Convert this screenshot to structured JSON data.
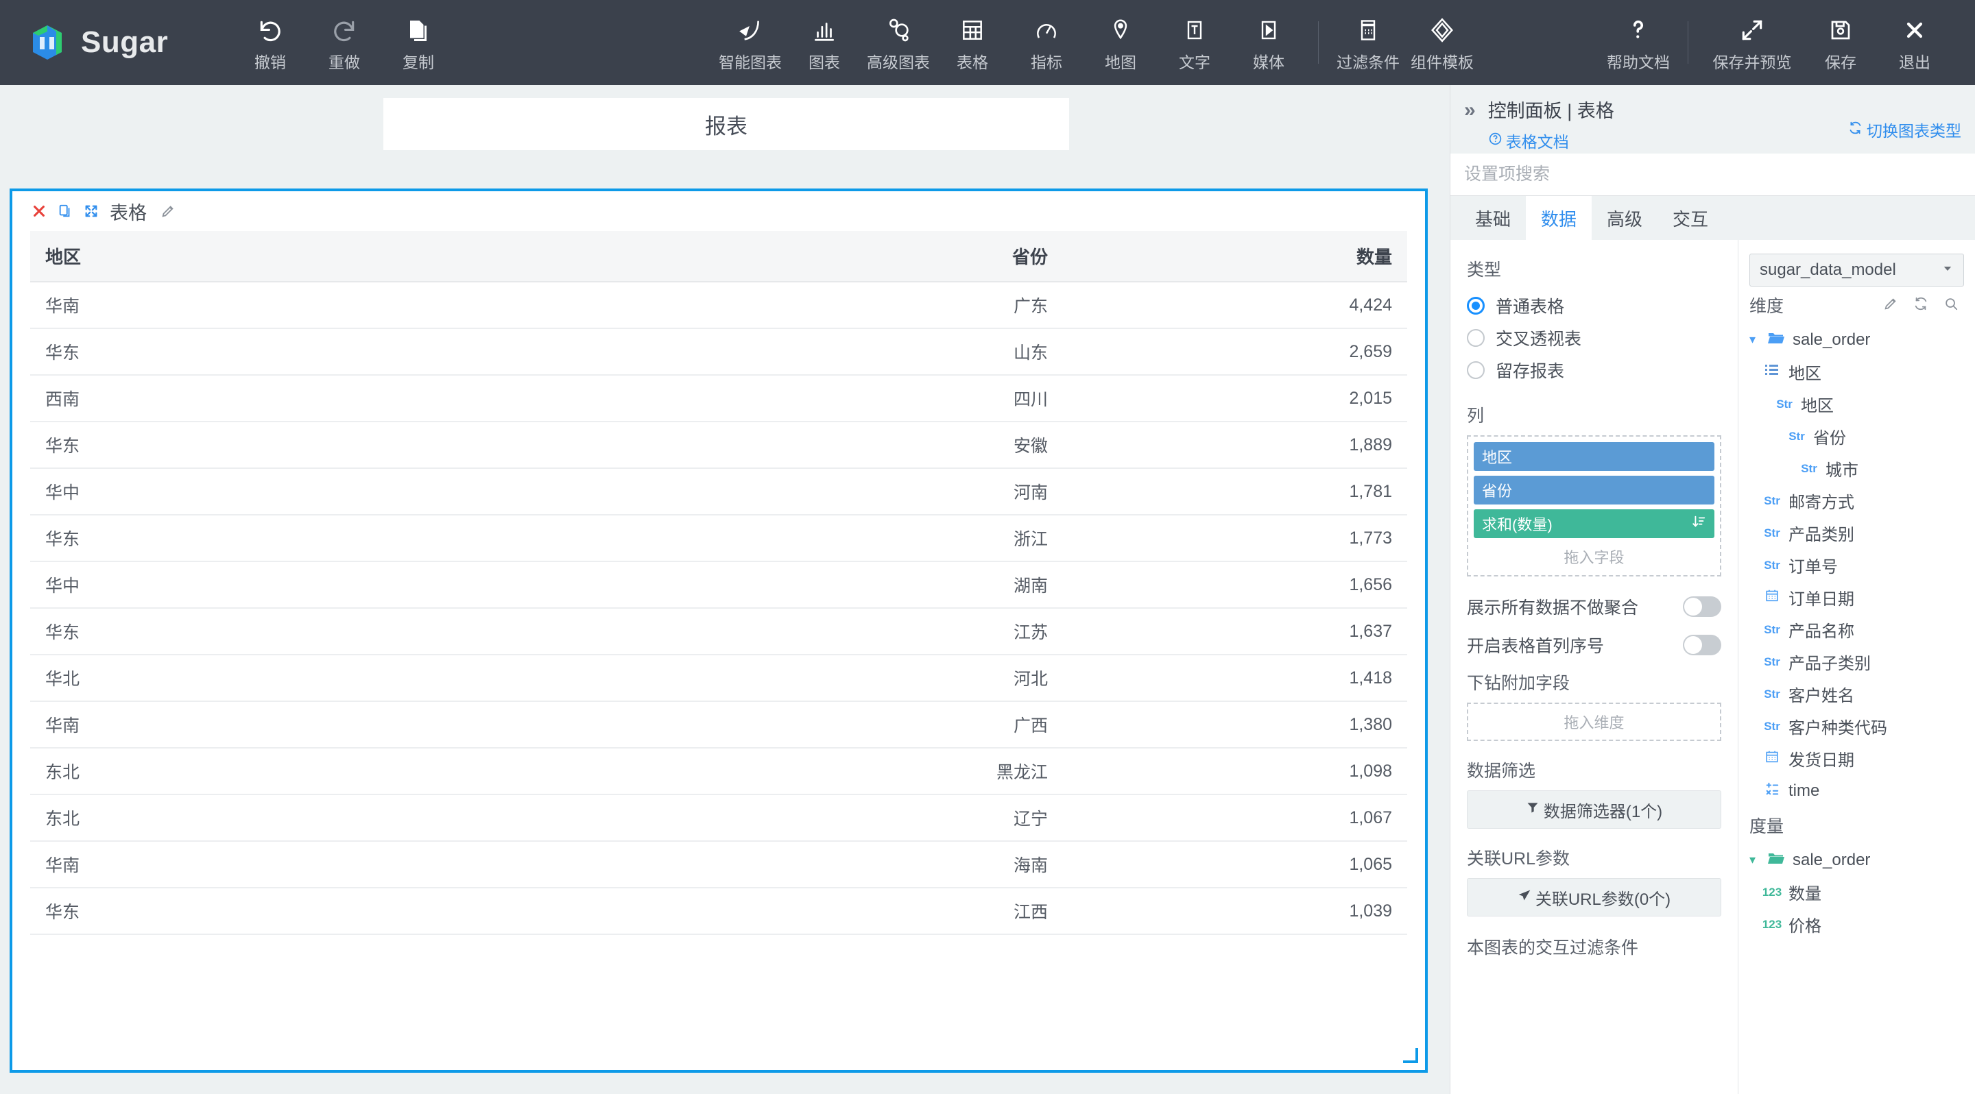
{
  "app": {
    "name": "Sugar"
  },
  "toolbar": {
    "left": [
      {
        "label": "撤销",
        "icon": "undo-icon"
      },
      {
        "label": "重做",
        "icon": "redo-icon"
      },
      {
        "label": "复制",
        "icon": "copy-icon"
      }
    ],
    "center": [
      {
        "label": "智能图表",
        "icon": "smart-chart-icon"
      },
      {
        "label": "图表",
        "icon": "bar-chart-icon"
      },
      {
        "label": "高级图表",
        "icon": "advanced-chart-icon"
      },
      {
        "label": "表格",
        "icon": "table-icon"
      },
      {
        "label": "指标",
        "icon": "metric-icon"
      },
      {
        "label": "地图",
        "icon": "map-icon"
      },
      {
        "label": "文字",
        "icon": "text-icon"
      },
      {
        "label": "媒体",
        "icon": "media-icon"
      }
    ],
    "center2": [
      {
        "label": "过滤条件",
        "icon": "filter-condition-icon"
      },
      {
        "label": "组件模板",
        "icon": "component-template-icon"
      }
    ],
    "right1": [
      {
        "label": "帮助文档",
        "icon": "question-mark-icon"
      }
    ],
    "right2": [
      {
        "label": "保存并预览",
        "icon": "expand-arrows-icon"
      },
      {
        "label": "保存",
        "icon": "floppy-disk-icon"
      },
      {
        "label": "退出",
        "icon": "close-x-icon"
      }
    ]
  },
  "canvas": {
    "report_title": "报表",
    "widget": {
      "title": "表格",
      "actions": [
        {
          "name": "delete-widget",
          "icon": "red-x-icon"
        },
        {
          "name": "copy-widget",
          "icon": "duplicate-icon"
        },
        {
          "name": "fullscreen-widget",
          "icon": "expand-icon"
        }
      ],
      "edit_icon": "pencil-icon"
    }
  },
  "chart_data": {
    "type": "table",
    "title": "表格",
    "columns": [
      "地区",
      "省份",
      "数量"
    ],
    "rows": [
      [
        "华南",
        "广东",
        "4,424"
      ],
      [
        "华东",
        "山东",
        "2,659"
      ],
      [
        "西南",
        "四川",
        "2,015"
      ],
      [
        "华东",
        "安徽",
        "1,889"
      ],
      [
        "华中",
        "河南",
        "1,781"
      ],
      [
        "华东",
        "浙江",
        "1,773"
      ],
      [
        "华中",
        "湖南",
        "1,656"
      ],
      [
        "华东",
        "江苏",
        "1,637"
      ],
      [
        "华北",
        "河北",
        "1,418"
      ],
      [
        "华南",
        "广西",
        "1,380"
      ],
      [
        "东北",
        "黑龙江",
        "1,098"
      ],
      [
        "东北",
        "辽宁",
        "1,067"
      ],
      [
        "华南",
        "海南",
        "1,065"
      ],
      [
        "华东",
        "江西",
        "1,039"
      ]
    ]
  },
  "panel": {
    "collapse_icon": "double-chevron-right-icon",
    "breadcrumb": "控制面板 | 表格",
    "doc_link": "表格文档",
    "doc_icon": "question-circle-icon",
    "switch_chart_type": "切换图表类型",
    "switch_icon": "refresh-icon",
    "search_placeholder": "设置项搜索",
    "search_value": "",
    "tabs": [
      {
        "label": "基础",
        "active": false
      },
      {
        "label": "数据",
        "active": true
      },
      {
        "label": "高级",
        "active": false
      },
      {
        "label": "交互",
        "active": false
      }
    ],
    "settings": {
      "type_label": "类型",
      "type_options": [
        {
          "label": "普通表格",
          "selected": true
        },
        {
          "label": "交叉透视表",
          "selected": false
        },
        {
          "label": "留存报表",
          "selected": false
        }
      ],
      "columns_label": "列",
      "columns_pills": [
        {
          "label": "地区",
          "kind": "dimension"
        },
        {
          "label": "省份",
          "kind": "dimension"
        },
        {
          "label": "求和(数量)",
          "kind": "measure",
          "sort_icon": "sort-desc-icon"
        }
      ],
      "columns_drop_hint": "拖入字段",
      "toggle_show_all": {
        "label": "展示所有数据不做聚合",
        "on": false
      },
      "toggle_row_index": {
        "label": "开启表格首列序号",
        "on": false
      },
      "drill_label": "下钻附加字段",
      "drill_drop_hint": "拖入维度",
      "data_filter_label": "数据筛选",
      "data_filter_button": "数据筛选器(1个)",
      "data_filter_icon": "funnel-icon",
      "url_param_label": "关联URL参数",
      "url_param_button": "关联URL参数(0个)",
      "url_param_icon": "paper-plane-icon",
      "interaction_filter_label": "本图表的交互过滤条件"
    },
    "fields": {
      "model": "sugar_data_model",
      "model_caret": "chevron-down-icon",
      "dimension_label": "维度",
      "dimension_tools": [
        {
          "icon": "pencil-icon",
          "name": "edit-dimensions"
        },
        {
          "icon": "refresh-icon",
          "name": "refresh-dimensions"
        },
        {
          "icon": "search-icon",
          "name": "search-dimensions"
        }
      ],
      "dimension_tree": [
        {
          "label": "sale_order",
          "type": "folder",
          "indent": 0,
          "caret": "expanded",
          "color": "blue"
        },
        {
          "label": "地区",
          "type": "hierarchy",
          "indent": 1,
          "tag": ""
        },
        {
          "label": "地区",
          "type": "field",
          "indent": 2,
          "tag": "Str"
        },
        {
          "label": "省份",
          "type": "field",
          "indent": 3,
          "tag": "Str"
        },
        {
          "label": "城市",
          "type": "field",
          "indent": 4,
          "tag": "Str"
        },
        {
          "label": "邮寄方式",
          "type": "field",
          "indent": 1,
          "tag": "Str"
        },
        {
          "label": "产品类别",
          "type": "field",
          "indent": 1,
          "tag": "Str"
        },
        {
          "label": "订单号",
          "type": "field",
          "indent": 1,
          "tag": "Str"
        },
        {
          "label": "订单日期",
          "type": "field",
          "indent": 1,
          "tag": "date"
        },
        {
          "label": "产品名称",
          "type": "field",
          "indent": 1,
          "tag": "Str"
        },
        {
          "label": "产品子类别",
          "type": "field",
          "indent": 1,
          "tag": "Str"
        },
        {
          "label": "客户姓名",
          "type": "field",
          "indent": 1,
          "tag": "Str"
        },
        {
          "label": "客户种类代码",
          "type": "field",
          "indent": 1,
          "tag": "Str"
        },
        {
          "label": "发货日期",
          "type": "field",
          "indent": 1,
          "tag": "date"
        },
        {
          "label": "time",
          "type": "field",
          "indent": 1,
          "tag": "calc"
        }
      ],
      "measure_label": "度量",
      "measure_tree": [
        {
          "label": "sale_order",
          "type": "folder",
          "indent": 0,
          "caret": "expanded",
          "color": "green"
        },
        {
          "label": "数量",
          "type": "field",
          "indent": 1,
          "tag": "123"
        },
        {
          "label": "价格",
          "type": "field",
          "indent": 1,
          "tag": "123"
        }
      ]
    }
  },
  "colors": {
    "toolbar_bg": "#3b414c",
    "page_bg": "#edf1f2",
    "accent_blue": "#0d9ae8",
    "link_blue": "#2f8ded",
    "dimension_pill": "#5b9bd5",
    "measure_pill": "#3fb899",
    "logo_green": "#2ecc71",
    "logo_blue": "#2b8ce6"
  }
}
